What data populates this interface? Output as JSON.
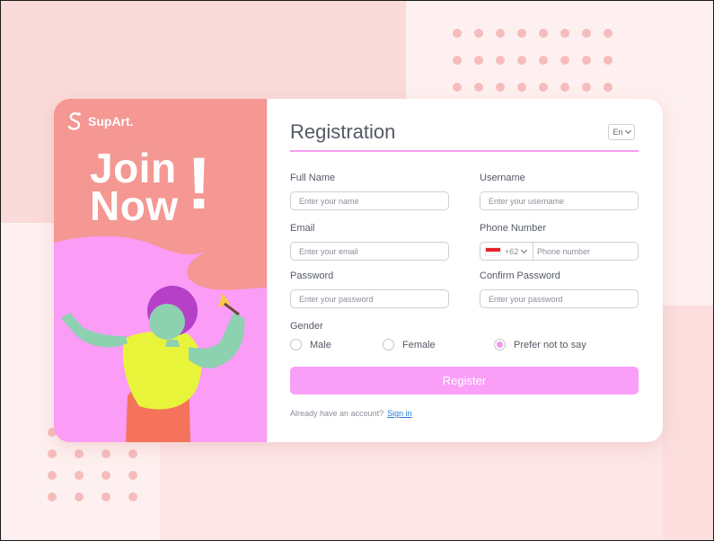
{
  "brand": {
    "name": "SupArt."
  },
  "hero": {
    "line1": "Join",
    "line2": "Now",
    "exclaim": "!"
  },
  "form": {
    "title": "Registration",
    "language": "En",
    "full_name": {
      "label": "Full Name",
      "placeholder": "Enter your name"
    },
    "username": {
      "label": "Username",
      "placeholder": "Enter your username"
    },
    "email": {
      "label": "Email",
      "placeholder": "Enter your email"
    },
    "phone": {
      "label": "Phone Number",
      "country_code": "+62",
      "placeholder": "Phone number"
    },
    "password": {
      "label": "Password",
      "placeholder": "Enter your password"
    },
    "confirm_password": {
      "label": "Confirm Password",
      "placeholder": "Enter your password"
    },
    "gender": {
      "label": "Gender",
      "options": [
        "Male",
        "Female",
        "Prefer not to say"
      ],
      "selected": "Prefer not to say"
    },
    "register_label": "Register",
    "signin_prompt": "Already have an account?",
    "signin_link": "Sign in"
  },
  "colors": {
    "accent_pink": "#fa9ff8",
    "panel_salmon": "#f59792",
    "illustration_pink": "#fb9cf6",
    "link_blue": "#2a7cd0"
  },
  "icons": [
    "logo-s-icon",
    "chevron-down-icon",
    "indonesia-flag-icon"
  ]
}
